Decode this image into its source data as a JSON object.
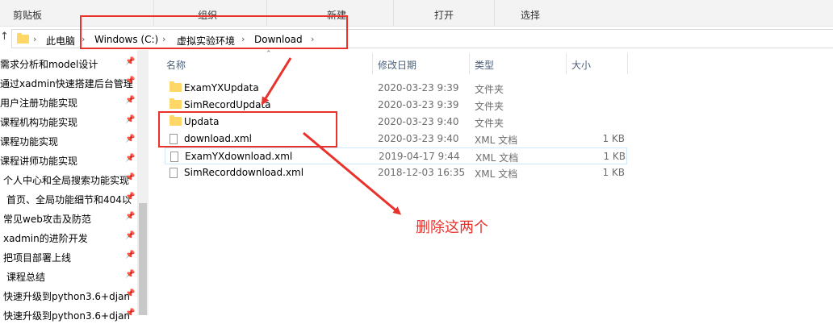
{
  "ribbon": {
    "clipboard": "剪贴板",
    "organize": "组织",
    "new": "新建",
    "open": "打开",
    "select": "选择"
  },
  "address": {
    "crumbs": [
      "此电脑",
      "Windows (C:)",
      "虚拟实验环境",
      "Download"
    ]
  },
  "sidebar": {
    "items": [
      {
        "label": "需求分析和model设计"
      },
      {
        "label": "通过xadmin快速搭建后台管理"
      },
      {
        "label": "用户注册功能实现"
      },
      {
        "label": "课程机构功能实现"
      },
      {
        "label": "课程功能实现"
      },
      {
        "label": "课程讲师功能实现"
      },
      {
        "label": "个人中心和全局搜索功能实现"
      },
      {
        "label": "首页、全局功能细节和404以"
      },
      {
        "label": "常见web攻击及防范"
      },
      {
        "label": "xadmin的进阶开发"
      },
      {
        "label": "把项目部署上线"
      },
      {
        "label": "课程总结"
      },
      {
        "label": "快速升级到python3.6+djan"
      },
      {
        "label": "快速升级到python3.6+djan"
      }
    ]
  },
  "columns": {
    "name": "名称",
    "modified": "修改日期",
    "type": "类型",
    "size": "大小"
  },
  "files": [
    {
      "name": "ExamYXUpdata",
      "modified": "2020-03-23 9:39",
      "type": "文件夹",
      "size": "",
      "kind": "folder"
    },
    {
      "name": "SimRecordUpdata",
      "modified": "2020-03-23 9:39",
      "type": "文件夹",
      "size": "",
      "kind": "folder"
    },
    {
      "name": "Updata",
      "modified": "2020-03-23 9:40",
      "type": "文件夹",
      "size": "",
      "kind": "folder"
    },
    {
      "name": "download.xml",
      "modified": "2020-03-23 9:40",
      "type": "XML 文档",
      "size": "1 KB",
      "kind": "file"
    },
    {
      "name": "ExamYXdownload.xml",
      "modified": "2019-04-17 9:44",
      "type": "XML 文档",
      "size": "1 KB",
      "kind": "file"
    },
    {
      "name": "SimRecorddownload.xml",
      "modified": "2018-12-03 16:35",
      "type": "XML 文档",
      "size": "1 KB",
      "kind": "file"
    }
  ],
  "annotation": {
    "text": "删除这两个",
    "color": "#e8322b"
  },
  "colors": {
    "folder": "#ffd766",
    "header_text": "#4c607a",
    "selection_border": "#cde8ff"
  }
}
